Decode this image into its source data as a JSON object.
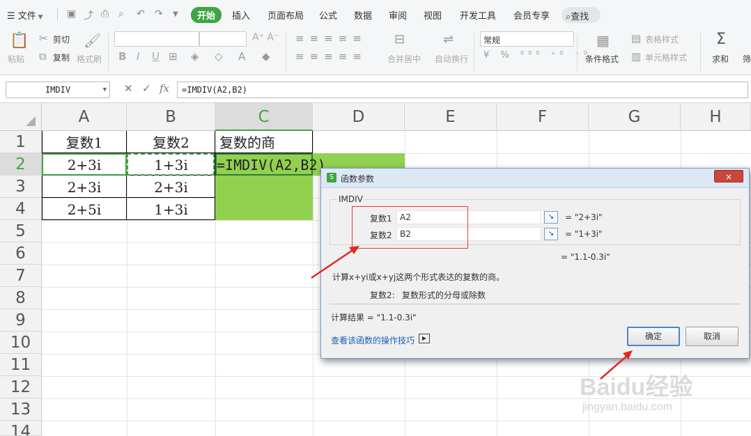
{
  "menubar": {
    "file_label": "文件",
    "tabs": [
      "开始",
      "插入",
      "页面布局",
      "公式",
      "数据",
      "审阅",
      "视图",
      "开发工具",
      "会员专享"
    ],
    "search_label": "查找"
  },
  "ribbon": {
    "paste": "粘贴",
    "cut": "剪切",
    "copy": "复制",
    "format_painter": "格式刷",
    "bold": "B",
    "italic": "I",
    "underline": "U",
    "number_format": "常规",
    "merge_center": "合并居中",
    "wrap_text": "自动换行",
    "conditional_format": "条件格式",
    "table_style": "表格样式",
    "cell_style": "单元格样式",
    "sum": "求和",
    "filter": "筛"
  },
  "formulabar": {
    "name_box": "IMDIV",
    "fx": "fx",
    "formula": "=IMDIV(A2,B2)"
  },
  "sheet": {
    "columns": [
      "A",
      "B",
      "C",
      "D",
      "E",
      "F",
      "G",
      "H"
    ],
    "rows": [
      "1",
      "2",
      "3",
      "4",
      "5",
      "6",
      "7",
      "8",
      "9",
      "10",
      "11",
      "12",
      "13",
      "14"
    ],
    "cells": {
      "A1": "复数1",
      "B1": "复数2",
      "C1": "复数的商",
      "A2": "2+3i",
      "B2": "1+3i",
      "C2": "=IMDIV(A2,B2)",
      "A3": "2+3i",
      "B3": "2+3i",
      "A4": "2+5i",
      "B4": "1+3i"
    },
    "colors": {
      "fill": "#92d050",
      "accent": "#3fa545"
    }
  },
  "dialog": {
    "title": "函数参数",
    "close": "×",
    "function_name": "IMDIV",
    "arg1_label": "复数1",
    "arg1_value": "A2",
    "arg1_result": "= \"2+3i\"",
    "arg2_label": "复数2",
    "arg2_value": "B2",
    "arg2_result": "= \"1+3i\"",
    "formula_result": "= \"1.1-0.3i\"",
    "description": "计算x+yi或x+yj这两个形式表达的复数的商。",
    "arg_desc_label": "复数2:",
    "arg_desc_text": "复数形式的分母或除数",
    "calc_result": "计算结果 = \"1.1-0.3i\"",
    "help_link": "查看该函数的操作技巧",
    "ok": "确定",
    "cancel": "取消"
  },
  "watermark": {
    "logo": "Baidu经验",
    "url": "jingyan.baidu.com"
  }
}
